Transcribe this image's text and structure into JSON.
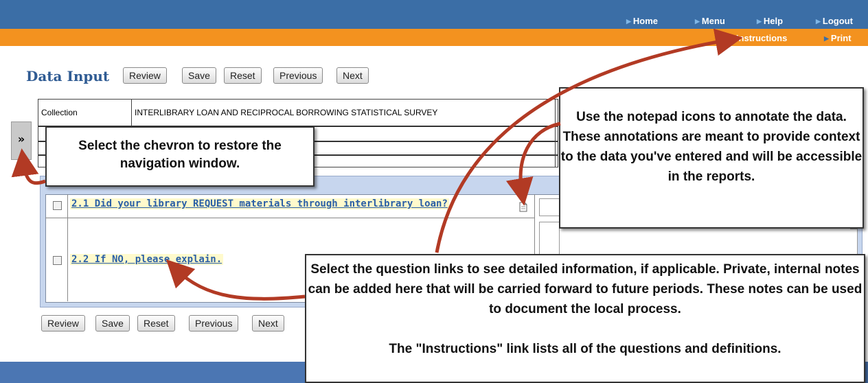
{
  "top_nav": [
    "Home",
    "Menu",
    "Help",
    "Logout"
  ],
  "orange_nav": [
    "Instructions",
    "Print"
  ],
  "page_title": "Data Input",
  "toolbar": [
    "Review",
    "Save",
    "Reset",
    "Previous",
    "Next"
  ],
  "grid": {
    "label": "Collection",
    "value": "INTERLIBRARY LOAN AND RECIPROCAL BORROWING STATISTICAL SURVEY"
  },
  "chevron": "»",
  "questions": [
    {
      "label": "2.1 Did your library REQUEST materials through interlibrary loan?"
    },
    {
      "label": "2.2 If NO, please explain."
    }
  ],
  "callouts": {
    "chevron_tip": "Select the chevron to restore the navigation window.",
    "notepad_tip": "Use the notepad icons to annotate the data.  These annotations are meant to provide context to the data you've entered and will be accessible in the reports.",
    "question_tip": "Select the question links to see detailed information, if applicable.  Private, internal notes can be added here that will be carried forward to future periods.  These notes can be used to document the local process.",
    "instructions_tip": "The \"Instructions\" link lists all of the questions and definitions."
  },
  "colors": {
    "nav_bar": "#3b6ea6",
    "orange_bar": "#f3921f",
    "panel": "#c7d6ee",
    "title": "#2f5b93",
    "question_link": "#2a5fa6",
    "arrow": "#b23a24"
  }
}
